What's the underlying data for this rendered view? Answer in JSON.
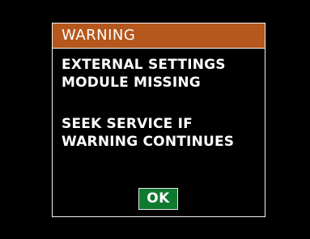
{
  "dialog": {
    "title": "WARNING",
    "message_lines_1": [
      "EXTERNAL SETTINGS",
      "MODULE MISSING"
    ],
    "message_lines_2": [
      "SEEK SERVICE IF",
      "WARNING CONTINUES"
    ],
    "ok_label": "OK"
  },
  "colors": {
    "background": "#000000",
    "title_bar": "#b4581e",
    "ok_button": "#0e7a2e",
    "text": "#ffffff",
    "border": "#f2f2f2"
  }
}
